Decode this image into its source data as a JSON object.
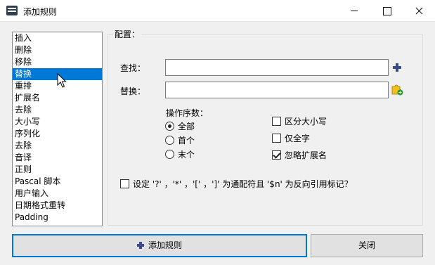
{
  "window": {
    "title": "添加规则"
  },
  "rules": {
    "items": [
      "插入",
      "删除",
      "移除",
      "替换",
      "重排",
      "扩展名",
      "去除",
      "大小写",
      "序列化",
      "去除",
      "音译",
      "正则",
      "Pascal 脚本",
      "用户输入",
      "日期格式重转",
      "Padding"
    ],
    "selected_index": 3
  },
  "config": {
    "title": "配置：",
    "find_label": "查找：",
    "find_value": "",
    "replace_label": "替换：",
    "replace_value": "",
    "occurrence_label": "操作序数：",
    "occurrence_options": [
      "全部",
      "首个",
      "末个"
    ],
    "occurrence_selected": "全部",
    "case_sensitive_label": "区分大小写",
    "case_sensitive": false,
    "whole_words_label": "仅全字",
    "whole_words": false,
    "skip_extension_label": "忽略扩展名",
    "skip_extension": true,
    "wildcards_label": "设定 '?' ，'*' ，'[' ，']' 为通配符且 '$n' 为反向引用标记？",
    "wildcards": false
  },
  "buttons": {
    "add_label": "添加规则",
    "close_label": "关闭"
  },
  "colors": {
    "selection": "#0078d7",
    "plus_icon": "#3c4a8a"
  }
}
